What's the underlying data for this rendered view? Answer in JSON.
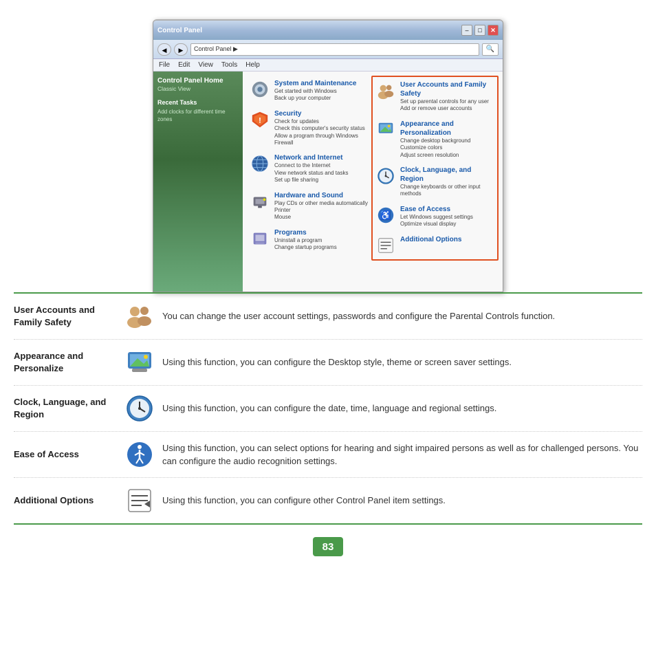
{
  "window": {
    "titlebar": {
      "title": "Control Panel",
      "btn_min": "–",
      "btn_max": "□",
      "btn_close": "✕"
    },
    "addressbar": {
      "back": "◀",
      "forward": "▶",
      "path": "Control Panel ▶",
      "search_icon": "🔍"
    },
    "menubar": [
      "File",
      "Edit",
      "View",
      "Tools",
      "Help"
    ]
  },
  "sidebar": {
    "title": "Control Panel Home",
    "subtitle": "Classic View",
    "recent_tasks": "Recent Tasks",
    "recent_item": "Add clocks for different time zones"
  },
  "left_column": [
    {
      "id": "system",
      "title": "System and Maintenance",
      "desc": "Get started with Windows\nBack up your computer",
      "icon": "⚙"
    },
    {
      "id": "security",
      "title": "Security",
      "desc": "Check for updates\nCheck this computer's security status\nAllow a program through Windows Firewall",
      "icon": "🛡"
    },
    {
      "id": "network",
      "title": "Network and Internet",
      "desc": "Connect to the Internet\nView network status and tasks\nSet up file sharing",
      "icon": "🌐"
    },
    {
      "id": "hardware",
      "title": "Hardware and Sound",
      "desc": "Play CDs or other media automatically\nPrinter\nMouse",
      "icon": "🖨"
    },
    {
      "id": "programs",
      "title": "Programs",
      "desc": "Uninstall a program\nChange startup programs",
      "icon": "📦"
    }
  ],
  "right_column": [
    {
      "id": "useraccts",
      "title": "User Accounts and Family Safety",
      "desc": "Set up parental controls for any user\nAdd or remove user accounts",
      "icon": "👥"
    },
    {
      "id": "appearance",
      "title": "Appearance and Personalization",
      "desc": "Change desktop background\nCustomize colors\nAdjust screen resolution",
      "icon": "🖼"
    },
    {
      "id": "clock",
      "title": "Clock, Language, and Region",
      "desc": "Change keyboards or other input methods",
      "icon": "🕐"
    },
    {
      "id": "ease",
      "title": "Ease of Access",
      "desc": "Let Windows suggest settings\nOptimize visual display",
      "icon": "♿"
    },
    {
      "id": "additional",
      "title": "Additional Options",
      "desc": "",
      "icon": "📋"
    }
  ],
  "info_rows": [
    {
      "id": "user-accounts",
      "title": "User Accounts and Family Safety",
      "icon_type": "users",
      "desc": "You can change the user account settings, passwords and configure the Parental Controls function."
    },
    {
      "id": "appearance",
      "title": "Appearance and Personalize",
      "icon_type": "appearance",
      "desc": "Using this function, you can configure the Desktop style, theme or screen saver settings."
    },
    {
      "id": "clock",
      "title": "Clock, Language, and Region",
      "icon_type": "clock",
      "desc": "Using this function, you can configure the date, time, language and regional settings."
    },
    {
      "id": "ease",
      "title": "Ease of Access",
      "icon_type": "ease",
      "desc": "Using this function, you can select options for hearing and sight impaired persons as well as for challenged persons. You can configure the audio recognition settings."
    },
    {
      "id": "additional",
      "title": "Additional Options",
      "icon_type": "additional",
      "desc": "Using this function, you can configure other Control Panel item settings."
    }
  ],
  "page_number": "83"
}
